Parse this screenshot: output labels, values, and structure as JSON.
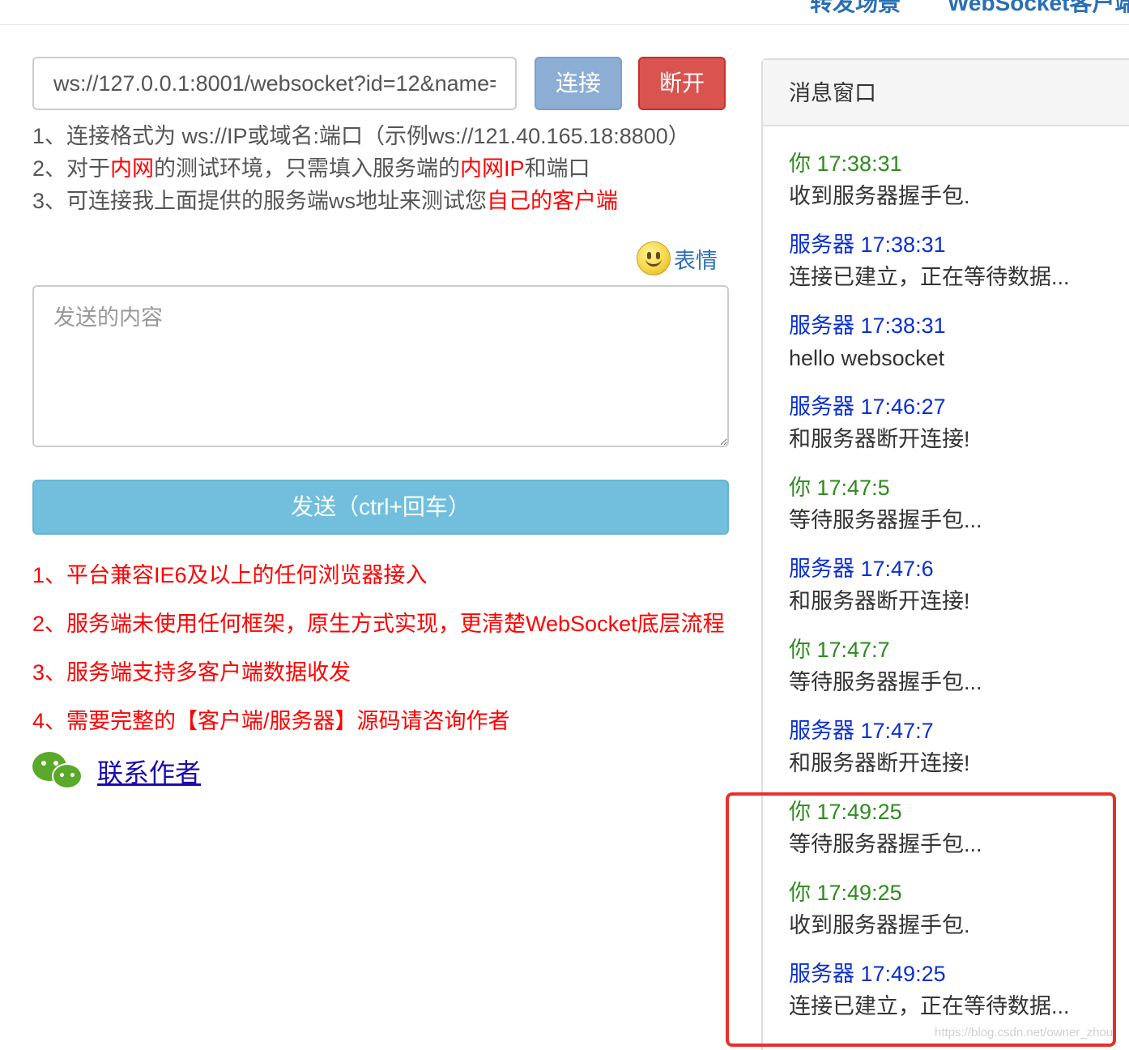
{
  "nav": {
    "item1": "转发场景",
    "item2": "WebSocket客户端"
  },
  "connection": {
    "url_value": "ws://127.0.0.1:8001/websocket?id=12&name=",
    "connect_label": "连接",
    "disconnect_label": "断开"
  },
  "tips": {
    "line1": "1、连接格式为 ws://IP或域名:端口（示例ws://121.40.165.18:8800）",
    "line2_a": "2、对于",
    "line2_red1": "内网",
    "line2_b": "的测试环境，只需填入服务端的",
    "line2_red2": "内网IP",
    "line2_c": "和端口",
    "line3_a": "3、可连接我上面提供的服务端ws地址来测试您",
    "line3_red": "自己的客户端"
  },
  "emoji": {
    "label": "表情",
    "icon": "smiley-icon"
  },
  "compose": {
    "placeholder": "发送的内容",
    "send_label": "发送（ctrl+回车）"
  },
  "features": [
    "1、平台兼容IE6及以上的任何浏览器接入",
    "2、服务端未使用任何框架，原生方式实现，更清楚WebSocket底层流程",
    "3、服务端支持多客户端数据收发",
    "4、需要完整的【客户端/服务器】源码请咨询作者"
  ],
  "contact": {
    "label": "联系作者",
    "icon": "wechat-icon"
  },
  "message_window": {
    "title": "消息窗口",
    "messages": [
      {
        "sender": "你 17:38:31",
        "role": "you",
        "text": "收到服务器握手包."
      },
      {
        "sender": "服务器 17:38:31",
        "role": "server",
        "text": "连接已建立，正在等待数据..."
      },
      {
        "sender": "服务器 17:38:31",
        "role": "server",
        "text": "hello websocket"
      },
      {
        "sender": "服务器 17:46:27",
        "role": "server",
        "text": "和服务器断开连接!"
      },
      {
        "sender": "你 17:47:5",
        "role": "you",
        "text": "等待服务器握手包..."
      },
      {
        "sender": "服务器 17:47:6",
        "role": "server",
        "text": "和服务器断开连接!"
      },
      {
        "sender": "你 17:47:7",
        "role": "you",
        "text": "等待服务器握手包..."
      },
      {
        "sender": "服务器 17:47:7",
        "role": "server",
        "text": "和服务器断开连接!"
      },
      {
        "sender": "你 17:49:25",
        "role": "you",
        "text": "等待服务器握手包..."
      },
      {
        "sender": "你 17:49:25",
        "role": "you",
        "text": "收到服务器握手包."
      },
      {
        "sender": "服务器 17:49:25",
        "role": "server",
        "text": "连接已建立，正在等待数据..."
      }
    ]
  },
  "colors": {
    "highlight": "#e8302a",
    "you": "#2e8b1e",
    "server": "#0a2fd0"
  },
  "watermark": "https://blog.csdn.net/owner_zhou"
}
